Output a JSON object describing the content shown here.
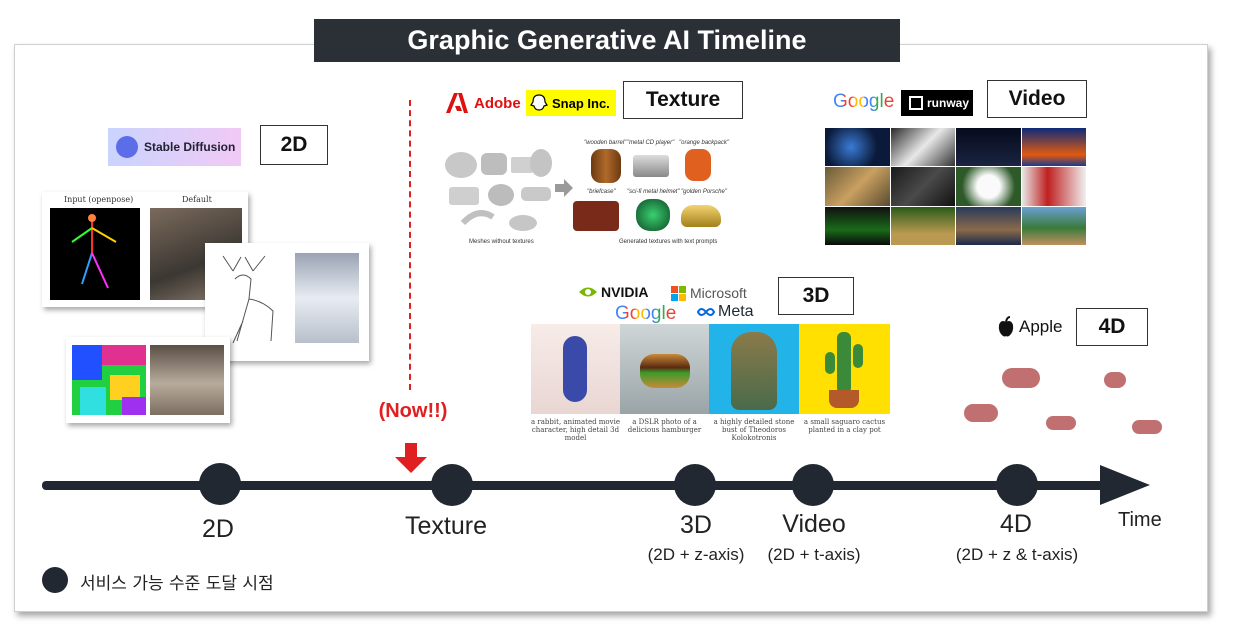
{
  "title": "Graphic Generative AI Timeline",
  "tags": {
    "d2": "2D",
    "texture": "Texture",
    "video": "Video",
    "d3": "3D",
    "d4": "4D"
  },
  "logos": {
    "stable_diffusion": "Stable Diffusion",
    "adobe": "Adobe",
    "snap": "Snap Inc.",
    "google_video": "Google",
    "runway": "runway",
    "nvidia": "NVIDIA",
    "microsoft": "Microsoft",
    "google_3d": "Google",
    "meta": "Meta",
    "apple": "Apple"
  },
  "texture_image": {
    "labels": [
      "\"wooden barrel\"",
      "\"metal CD player\"",
      "\"orange backpack\"",
      "\"briefcase\"",
      "\"sci-fi metal helmet\"",
      "\"golden Porsche\""
    ],
    "left_caption": "Meshes without textures",
    "right_caption": "Generated textures with text prompts"
  },
  "pose_image": {
    "label_left": "Input (openpose)",
    "label_right": "Default"
  },
  "three_d_captions": [
    "a rabbit, animated movie character, high detail 3d model",
    "a DSLR photo of a delicious hamburger",
    "a highly detailed stone bust of Theodoros Kolokotronis",
    "a small saguaro cactus planted in a clay pot"
  ],
  "now_label": "(Now!!)",
  "timeline": {
    "axis_title": "Time",
    "milestones": [
      {
        "label": "2D",
        "sub": ""
      },
      {
        "label": "Texture",
        "sub": ""
      },
      {
        "label": "3D",
        "sub": "(2D + z-axis)"
      },
      {
        "label": "Video",
        "sub": "(2D + t-axis)"
      },
      {
        "label": "4D",
        "sub": "(2D + z & t-axis)"
      }
    ]
  },
  "legend": "서비스 가능 수준 도달 시점",
  "colors": {
    "title_bg": "#2b2f36",
    "axis": "#222831",
    "now": "#e02020",
    "adobe": "#e01010",
    "snap": "#fffc00",
    "nvidia": "#76b900"
  }
}
